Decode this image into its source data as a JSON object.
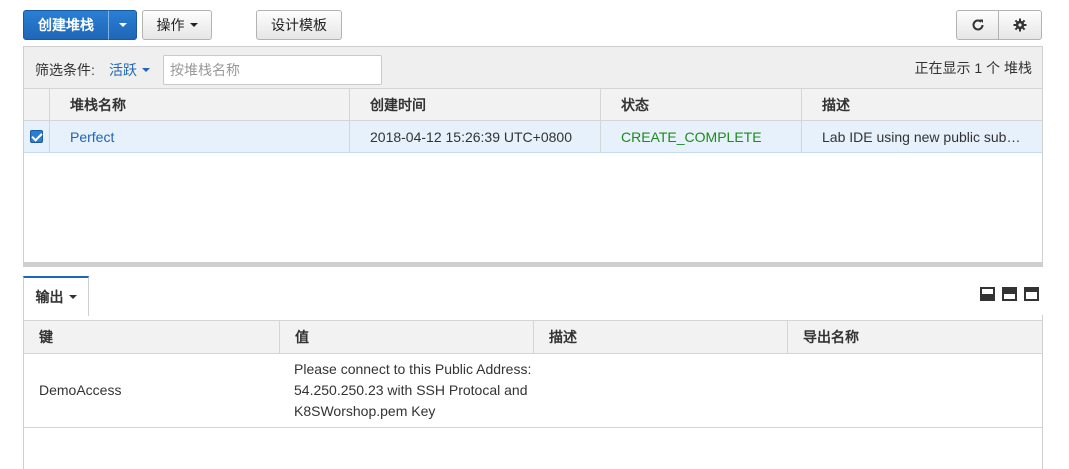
{
  "toolbar": {
    "create_label": "创建堆栈",
    "action_label": "操作",
    "template_label": "设计模板",
    "refresh_icon": "refresh-icon",
    "settings_icon": "gear-icon",
    "primary_color": "#1f66b8"
  },
  "filter": {
    "label": "筛选条件:",
    "value": "活跃",
    "search_placeholder": "按堆栈名称",
    "showing_text": "正在显示 1 个 堆栈"
  },
  "stacks": {
    "columns": [
      "堆栈名称",
      "创建时间",
      "状态",
      "描述"
    ],
    "rows": [
      {
        "selected": true,
        "name": "Perfect",
        "created": "2018-04-12 15:26:39 UTC+0800",
        "status": "CREATE_COMPLETE",
        "description": "Lab IDE using new public sub…"
      }
    ]
  },
  "output": {
    "tab_label": "输出",
    "columns": [
      "键",
      "值",
      "描述",
      "导出名称"
    ],
    "rows": [
      {
        "key": "DemoAccess",
        "value": "Please connect to this Public Address: 54.250.250.23 with SSH Protocal and K8SWorshop.pem Key",
        "description": "",
        "export_name": ""
      }
    ],
    "status_color": "#1d8a1d"
  }
}
